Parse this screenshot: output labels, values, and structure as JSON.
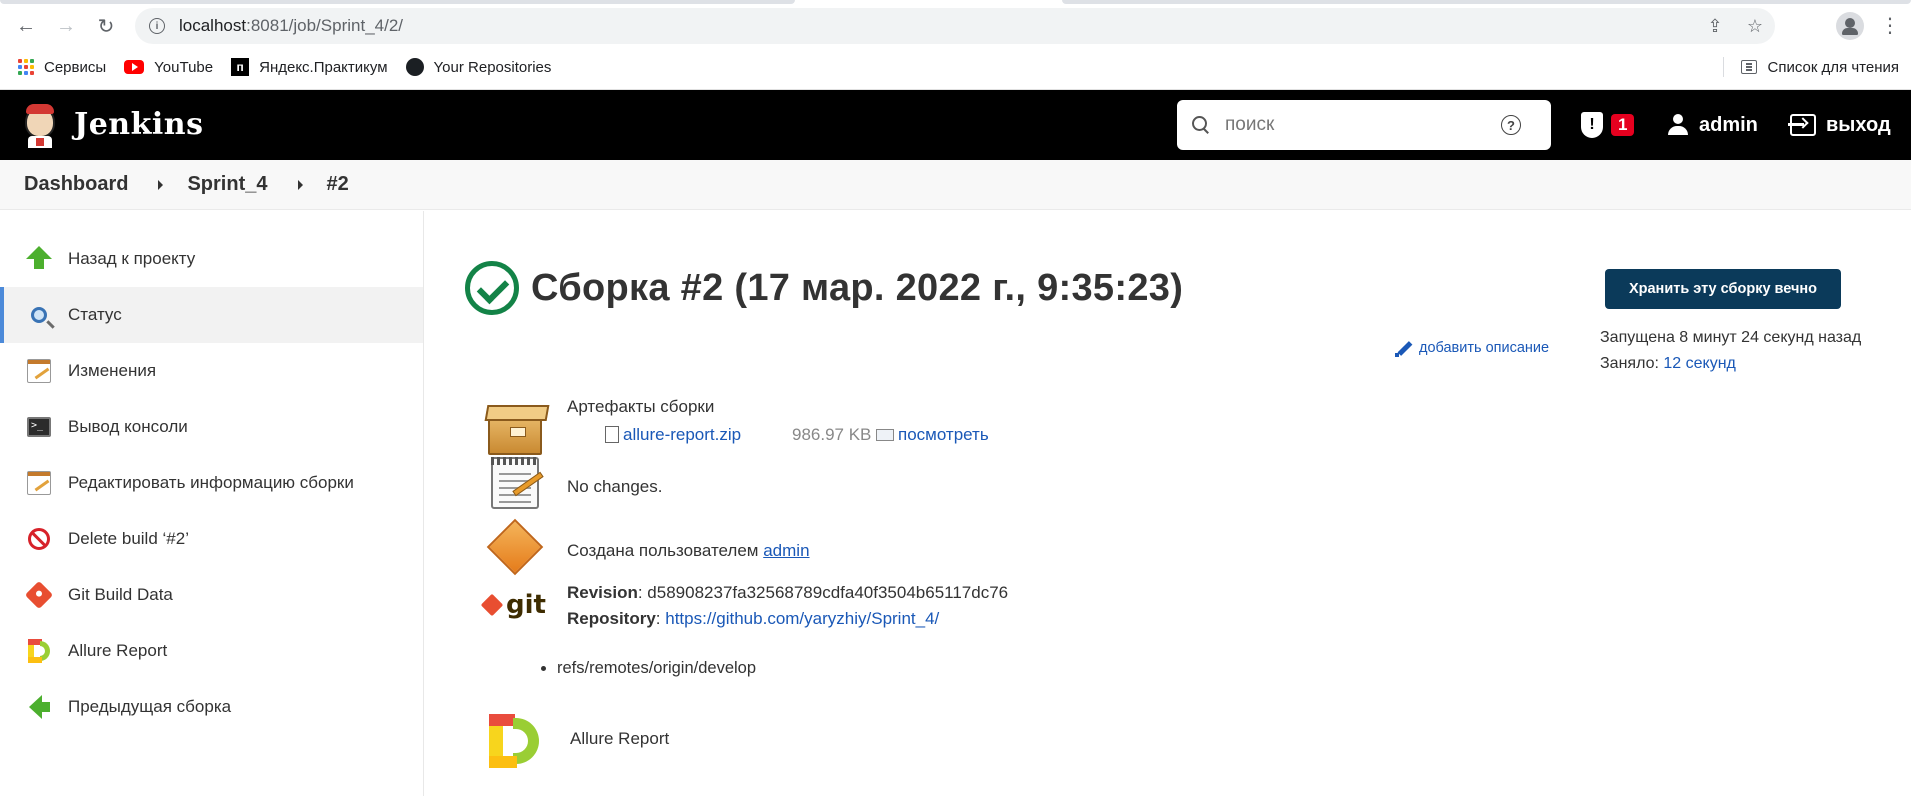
{
  "browser": {
    "url_host": "localhost",
    "url_path": ":8081/job/Sprint_4/2/",
    "bookmarks": [
      {
        "label": "Сервисы",
        "icon": "apps-grid-icon"
      },
      {
        "label": "YouTube",
        "icon": "youtube-icon"
      },
      {
        "label": "Яндекс.Практикум",
        "icon": "yandex-practicum-icon"
      },
      {
        "label": "Your Repositories",
        "icon": "github-icon"
      }
    ],
    "reading_list": "Список для чтения"
  },
  "header": {
    "title": "Jenkins",
    "search_placeholder": "поиск",
    "security_count": "1",
    "user": "admin",
    "logout": "выход"
  },
  "breadcrumb": [
    "Dashboard",
    "Sprint_4",
    "#2"
  ],
  "sidebar": {
    "items": [
      {
        "label": "Назад к проекту",
        "icon": "up-arrow-icon",
        "active": false
      },
      {
        "label": "Статус",
        "icon": "magnifier-icon",
        "active": true
      },
      {
        "label": "Изменения",
        "icon": "notepad-icon",
        "active": false
      },
      {
        "label": "Вывод консоли",
        "icon": "terminal-icon",
        "active": false
      },
      {
        "label": "Редактировать информацию сборки",
        "icon": "notepad-edit-icon",
        "active": false
      },
      {
        "label": "Delete build ‘#2’",
        "icon": "delete-icon",
        "active": false
      },
      {
        "label": "Git Build Data",
        "icon": "git-icon",
        "active": false
      },
      {
        "label": "Allure Report",
        "icon": "allure-icon",
        "active": false
      },
      {
        "label": "Предыдущая сборка",
        "icon": "back-arrow-icon",
        "active": false
      }
    ]
  },
  "build": {
    "title": "Сборка #2 (17 мар. 2022 г., 9:35:23)",
    "status": "success",
    "keep_button": "Хранить эту сборку вечно",
    "started": "Запущена 8 минут 24 секунд назад",
    "took_label": "Заняло: ",
    "took_value": "12 секунд",
    "add_description": "добавить описание",
    "artifacts_title": "Артефакты сборки",
    "artifact_file": "allure-report.zip",
    "artifact_size": "986.97 KB",
    "artifact_view": "посмотреть",
    "no_changes": "No changes.",
    "created_by_label": "Создана пользователем ",
    "created_by_user": "admin",
    "revision_label": "Revision",
    "revision_value": ": d58908237fa32568789cdfa40f3504b65117dc76",
    "repository_label": "Repository",
    "repository_sep": ": ",
    "repository_url": "https://github.com/yaryzhiy/Sprint_4/",
    "git_logo_text": "git",
    "branches": [
      "refs/remotes/origin/develop"
    ],
    "allure_link": "Allure Report"
  },
  "colors": {
    "header_bg": "#000000",
    "success_green": "#138347",
    "link_blue": "#1a58b7",
    "keep_button_bg": "#0b3a5a",
    "badge_red": "#e6001f"
  }
}
